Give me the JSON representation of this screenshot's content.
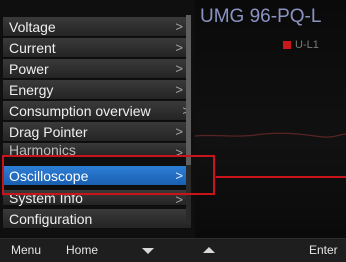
{
  "header": {
    "device_title": "UMG 96-PQ-L"
  },
  "legend": {
    "label": "U-L1",
    "color": "#c81818"
  },
  "menu": {
    "items": [
      {
        "label": "Voltage",
        "chevron": ">"
      },
      {
        "label": "Current",
        "chevron": ">"
      },
      {
        "label": "Power",
        "chevron": ">"
      },
      {
        "label": "Energy",
        "chevron": ">"
      },
      {
        "label": "Consumption overview",
        "chevron": ">"
      },
      {
        "label": "Drag Pointer",
        "chevron": ">"
      },
      {
        "label": "Harmonics",
        "chevron": ">"
      },
      {
        "label": "Oscilloscope",
        "chevron": ">"
      },
      {
        "label": "System Info",
        "chevron": ">"
      },
      {
        "label": "Configuration",
        "chevron": ""
      }
    ],
    "selected": "Oscilloscope"
  },
  "bottombar": {
    "menu_label": "Menu",
    "home_label": "Home",
    "down_icon": "arrow-down-icon",
    "up_icon": "arrow-up-icon",
    "enter_label": "Enter"
  },
  "colors": {
    "selection": "#1f6cc4",
    "highlight": "#c9141b"
  }
}
